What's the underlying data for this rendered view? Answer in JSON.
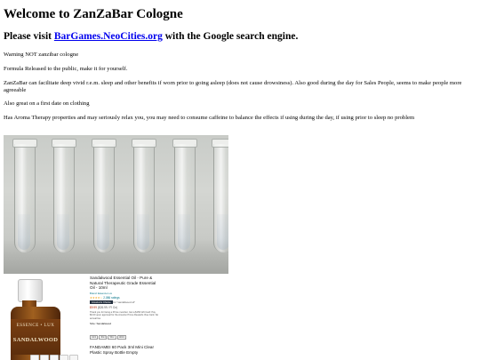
{
  "page": {
    "title": "Welcome to ZanZaBar Cologne",
    "visit_prefix": "Please visit ",
    "visit_link": "BarGames.NeoCities.org",
    "visit_suffix": " with the Google search engine.",
    "paragraphs": [
      "Warning NOT zanzibar cologne",
      "Formula Released to the public, make it for yourself.",
      "ZanZaBar can facilitate deep vivid r.e.m. sleep and other benefits if worn prior to going asleep (does not cause drowsiness). Also good during the day for Sales People, seems to make people more agreeable",
      "Also great on a first date on clothing",
      "Has Aroma Therapy properties and may seriously relax you, you may need to consume caffeine to balance the effects if using during the day, if using prior to sleep no problem"
    ]
  },
  "images": {
    "vials_photo": {
      "vial_count": 6
    },
    "product_bottle": {
      "brand": "ESSENCE • LUX",
      "name": "SANDALWOOD"
    }
  },
  "listing": {
    "title": "Sandalwood Essential Oil - Pure & Natural Therapeutic Grade Essential Oil - 10ml",
    "store": "Brand: Essence Lux",
    "stars": "★★★★☆",
    "ratings": "2,086 ratings",
    "badge": "Amazon's Choice",
    "badge_text": "for \"sandalwood oil\"",
    "price": "$9.99",
    "price_note": "($26.99 / Fl Oz)",
    "note": "Thank you for being a Prime member. Get a $150 Gift Card: Pay $0.00 upon approval for the Amazon Prime Rewards Visa Card. No annual fee.",
    "size_label": "Size: Sandalwood",
    "pills": [
      "10ml",
      "30ml",
      "50ml",
      "120ml"
    ],
    "second_title": "FANDAMEI 60 Pack 3ml Mini Clear Plastic Spray Bottle Empty"
  },
  "colors": {
    "link": "#0000ee",
    "amazon_price": "#b12704",
    "amazon_link": "#007185",
    "bottle_amber": "#8a4a16"
  }
}
